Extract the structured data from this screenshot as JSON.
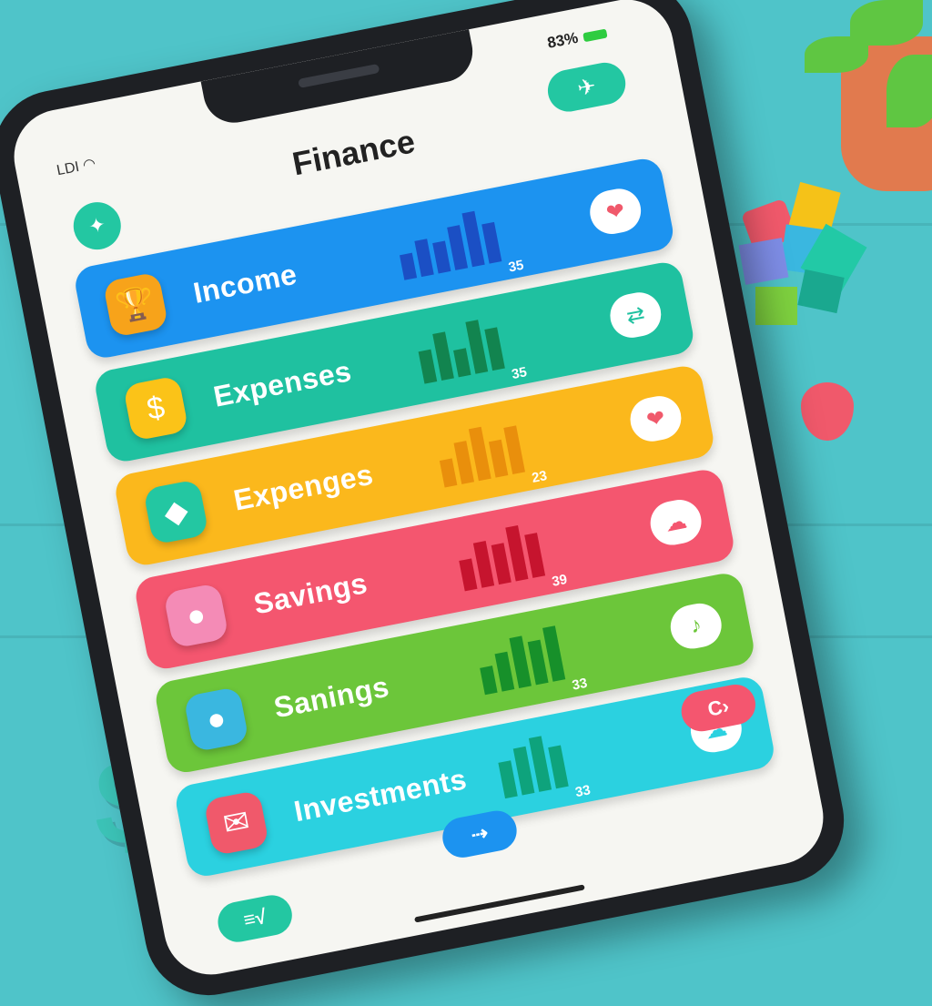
{
  "status_bar": {
    "carrier": "LDI",
    "battery": "83%"
  },
  "app": {
    "title": "Finance"
  },
  "cards": [
    {
      "label": "Income",
      "value": "35",
      "color": "#1c93f0",
      "bar_color": "#1b4fc4",
      "icon": "bowl-icon",
      "badge": "heart-icon"
    },
    {
      "label": "Expenses",
      "value": "35",
      "color": "#1fc1a0",
      "bar_color": "#12844f",
      "icon": "dollar-coin-icon",
      "badge": "exchange-icon"
    },
    {
      "label": "Expenges",
      "value": "23",
      "color": "#fbb81c",
      "bar_color": "#e98f0c",
      "icon": "bird-icon",
      "badge": "heart-icon"
    },
    {
      "label": "Savings",
      "value": "39",
      "color": "#f4566f",
      "bar_color": "#c6142e",
      "icon": "pig-icon",
      "badge": "cloud-icon"
    },
    {
      "label": "Sanings",
      "value": "33",
      "color": "#6cc63a",
      "bar_color": "#17902a",
      "icon": "bear-icon",
      "badge": "note-icon"
    },
    {
      "label": "Investments",
      "value": "33",
      "color": "#2bd1e0",
      "bar_color": "#0ea37c",
      "icon": "envelope-icon",
      "badge": "cloud-icon"
    }
  ],
  "bottom": {
    "btn_left": "≡√",
    "btn_center": "⇢",
    "btn_right": "C›"
  },
  "decor": {
    "dollar": "$"
  }
}
